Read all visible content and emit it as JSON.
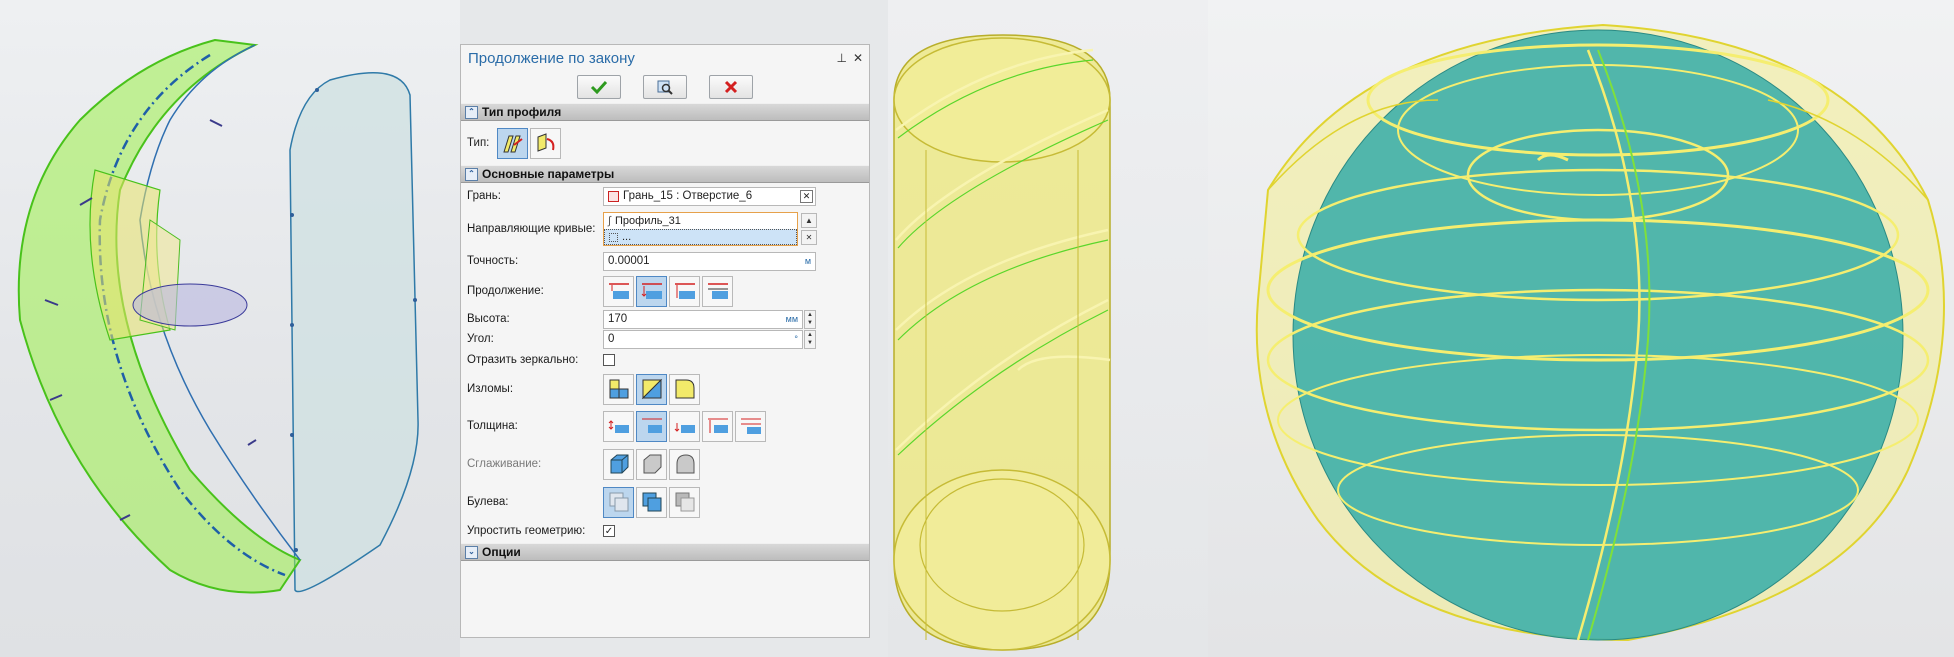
{
  "dialog": {
    "title": "Продолжение по закону",
    "pin_icon": "pin-icon",
    "close_icon": "close-icon",
    "toolbar": [
      "confirm-checkmark-icon",
      "preview-icon",
      "cancel-x-icon"
    ],
    "sections": {
      "profile_type": "Тип профиля",
      "main_params": "Основные параметры",
      "options": "Опции"
    },
    "type_label": "Тип:",
    "face": {
      "label": "Грань:",
      "value": "Грань_15 : Отверстие_6"
    },
    "guide_curves": {
      "label": "Направляющие кривые:",
      "items": [
        "Профиль_31",
        "..."
      ]
    },
    "precision": {
      "label": "Точность:",
      "value": "0.00001",
      "unit": "м"
    },
    "continuation_label": "Продолжение:",
    "height": {
      "label": "Высота:",
      "value": "170",
      "unit": "мм"
    },
    "angle": {
      "label": "Угол:",
      "value": "0",
      "unit": "°"
    },
    "mirror_label": "Отразить зеркально:",
    "kinks_label": "Изломы:",
    "thickness_label": "Толщина:",
    "smoothing_label": "Сглаживание:",
    "boolean_label": "Булева:",
    "simplify_label": "Упростить геометрию:",
    "simplify_checked": true,
    "mirror_checked": false
  },
  "colors": {
    "accent": "#2a6ca8",
    "green_solid": "#7fe03a",
    "yellow_solid": "#f2ea6a",
    "teal_sphere": "#3aaea8"
  }
}
